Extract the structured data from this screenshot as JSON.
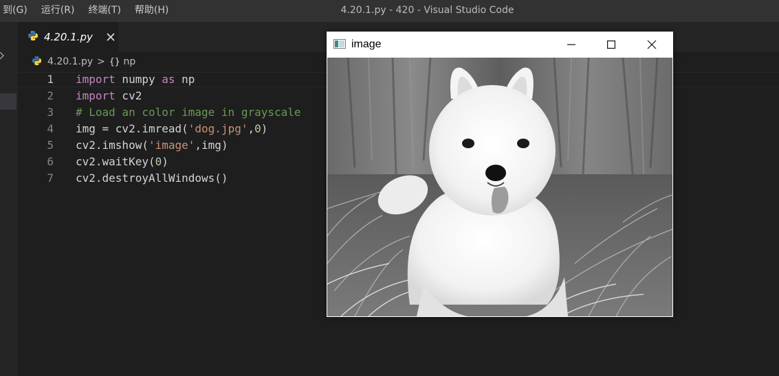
{
  "menu": [
    "到(G)",
    "运行(R)",
    "终端(T)",
    "帮助(H)"
  ],
  "window_title": "4.20.1.py - 420 - Visual Studio Code",
  "tab": {
    "label": "4.20.1.py",
    "icon": "python-icon",
    "close_icon": "close-icon"
  },
  "breadcrumb": {
    "file": "4.20.1.py",
    "symbol_icon": "{}",
    "symbol": "np",
    "separator": ">"
  },
  "editor": {
    "active_line": 1,
    "lines": [
      {
        "number": "1",
        "tokens": [
          {
            "t": "import",
            "k": "keyword"
          },
          {
            "t": " numpy ",
            "k": "plain"
          },
          {
            "t": "as",
            "k": "keyword"
          },
          {
            "t": " np",
            "k": "plain"
          }
        ]
      },
      {
        "number": "2",
        "tokens": [
          {
            "t": "import",
            "k": "keyword"
          },
          {
            "t": " cv2",
            "k": "plain"
          }
        ]
      },
      {
        "number": "3",
        "tokens": [
          {
            "t": "# Load an color image in grayscale",
            "k": "comment"
          }
        ]
      },
      {
        "number": "4",
        "tokens": [
          {
            "t": "img = cv2.imread(",
            "k": "plain"
          },
          {
            "t": "'dog.jpg'",
            "k": "string"
          },
          {
            "t": ",",
            "k": "plain"
          },
          {
            "t": "0",
            "k": "number"
          },
          {
            "t": ")",
            "k": "plain"
          }
        ]
      },
      {
        "number": "5",
        "tokens": [
          {
            "t": "cv2.imshow(",
            "k": "plain"
          },
          {
            "t": "'image'",
            "k": "string"
          },
          {
            "t": ",img)",
            "k": "plain"
          }
        ]
      },
      {
        "number": "6",
        "tokens": [
          {
            "t": "cv2.waitKey(",
            "k": "plain"
          },
          {
            "t": "0",
            "k": "number"
          },
          {
            "t": ")",
            "k": "plain"
          }
        ]
      },
      {
        "number": "7",
        "tokens": [
          {
            "t": "cv2.destroyAllWindows()",
            "k": "plain"
          }
        ]
      }
    ]
  },
  "image_window": {
    "title": "image",
    "app_icon": "opencv-window-icon",
    "buttons": [
      "minimize-icon",
      "maximize-icon",
      "close-icon"
    ],
    "content": "grayscale-photo-of-white-puppy"
  },
  "colors": {
    "background": "#1e1e1e",
    "titlebar": "#323233",
    "keyword": "#c586c0",
    "string": "#ce9178",
    "comment": "#6a9955",
    "number": "#b5cea8",
    "python_blue": "#3776ab",
    "python_yellow": "#ffd43b"
  }
}
